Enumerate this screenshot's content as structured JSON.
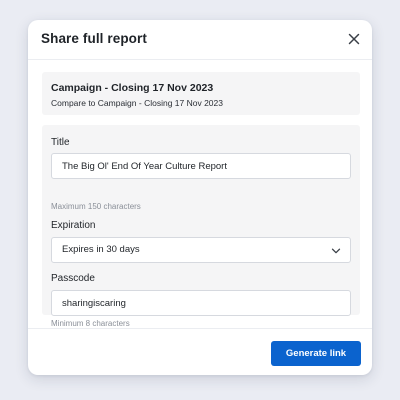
{
  "modal": {
    "title": "Share full report",
    "close_icon": "close-icon"
  },
  "campaign": {
    "title": "Campaign - Closing 17 Nov 2023",
    "compare": "Compare to Campaign - Closing 17 Nov 2023"
  },
  "form": {
    "title_label": "Title",
    "title_value": "The Big Ol' End Of Year Culture Report",
    "title_hint": "Maximum 150 characters",
    "expiration_label": "Expiration",
    "expiration_value": "Expires in 30 days",
    "expiration_icon": "chevron-down-icon",
    "passcode_label": "Passcode",
    "passcode_value": "sharingiscaring",
    "passcode_hint": "Minimum 8 characters"
  },
  "footer": {
    "generate_label": "Generate link"
  },
  "colors": {
    "primary": "#0b63ce",
    "background": "#eaecf3",
    "panel": "#f5f5f6"
  }
}
